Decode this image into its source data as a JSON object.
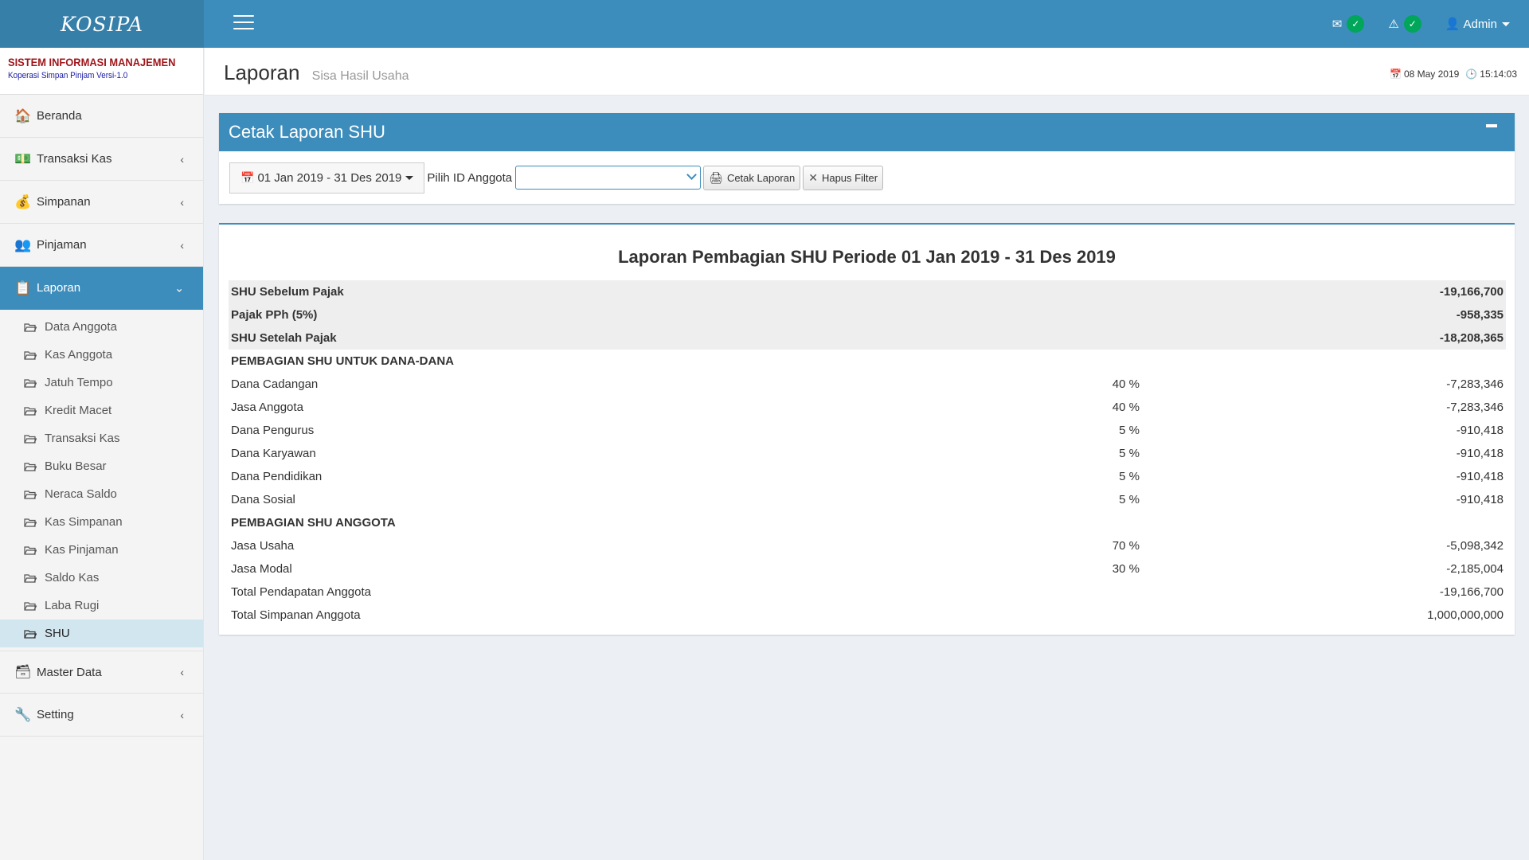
{
  "app": {
    "logo": "KOSIPA"
  },
  "topbar": {
    "mail_icon": "envelope-icon",
    "alert_icon": "warning-icon",
    "user_label": "Admin"
  },
  "brand": {
    "title": "SISTEM INFORMASI MANAJEMEN",
    "subtitle": "Koperasi Simpan Pinjam Versi-1.0"
  },
  "sidebar": {
    "items": [
      {
        "label": "Beranda",
        "icon": "home-icon"
      },
      {
        "label": "Transaksi Kas",
        "icon": "cash-register-icon"
      },
      {
        "label": "Simpanan",
        "icon": "money-bag-icon"
      },
      {
        "label": "Pinjaman",
        "icon": "people-icon"
      },
      {
        "label": "Laporan",
        "icon": "report-icon"
      },
      {
        "label": "Master Data",
        "icon": "database-icon"
      },
      {
        "label": "Setting",
        "icon": "wrench-icon"
      }
    ],
    "submenu": [
      "Data Anggota",
      "Kas Anggota",
      "Jatuh Tempo",
      "Kredit Macet",
      "Transaksi Kas",
      "Buku Besar",
      "Neraca Saldo",
      "Kas Simpanan",
      "Kas Pinjaman",
      "Saldo Kas",
      "Laba Rugi",
      "SHU"
    ]
  },
  "header": {
    "title": "Laporan",
    "subtitle": "Sisa Hasil Usaha",
    "date": "08 May 2019",
    "time": "15:14:03"
  },
  "filter": {
    "box_title": "Cetak Laporan SHU",
    "date_range": "01 Jan 2019 - 31 Des 2019",
    "member_label": "Pilih ID Anggota",
    "member_value": "",
    "print_label": "Cetak Laporan",
    "clear_label": "Hapus Filter"
  },
  "report": {
    "title": "Laporan Pembagian SHU Periode 01 Jan 2019 - 31 Des 2019",
    "summary": [
      {
        "label": "SHU Sebelum Pajak",
        "value": "-19,166,700"
      },
      {
        "label": "Pajak PPh (5%)",
        "value": "-958,335"
      },
      {
        "label": "SHU Setelah Pajak",
        "value": "-18,208,365"
      }
    ],
    "section1": "PEMBAGIAN SHU UNTUK DANA-DANA",
    "funds": [
      {
        "label": "Dana Cadangan",
        "pct": "40 %",
        "value": "-7,283,346"
      },
      {
        "label": "Jasa Anggota",
        "pct": "40 %",
        "value": "-7,283,346"
      },
      {
        "label": "Dana Pengurus",
        "pct": "5 %",
        "value": "-910,418"
      },
      {
        "label": "Dana Karyawan",
        "pct": "5 %",
        "value": "-910,418"
      },
      {
        "label": "Dana Pendidikan",
        "pct": "5 %",
        "value": "-910,418"
      },
      {
        "label": "Dana Sosial",
        "pct": "5 %",
        "value": "-910,418"
      }
    ],
    "section2": "PEMBAGIAN SHU ANGGOTA",
    "members": [
      {
        "label": "Jasa Usaha",
        "pct": "70 %",
        "value": "-5,098,342"
      },
      {
        "label": "Jasa Modal",
        "pct": "30 %",
        "value": "-2,185,004"
      },
      {
        "label": "Total Pendapatan Anggota",
        "pct": "",
        "value": "-19,166,700"
      },
      {
        "label": "Total Simpanan Anggota",
        "pct": "",
        "value": "1,000,000,000"
      }
    ]
  }
}
